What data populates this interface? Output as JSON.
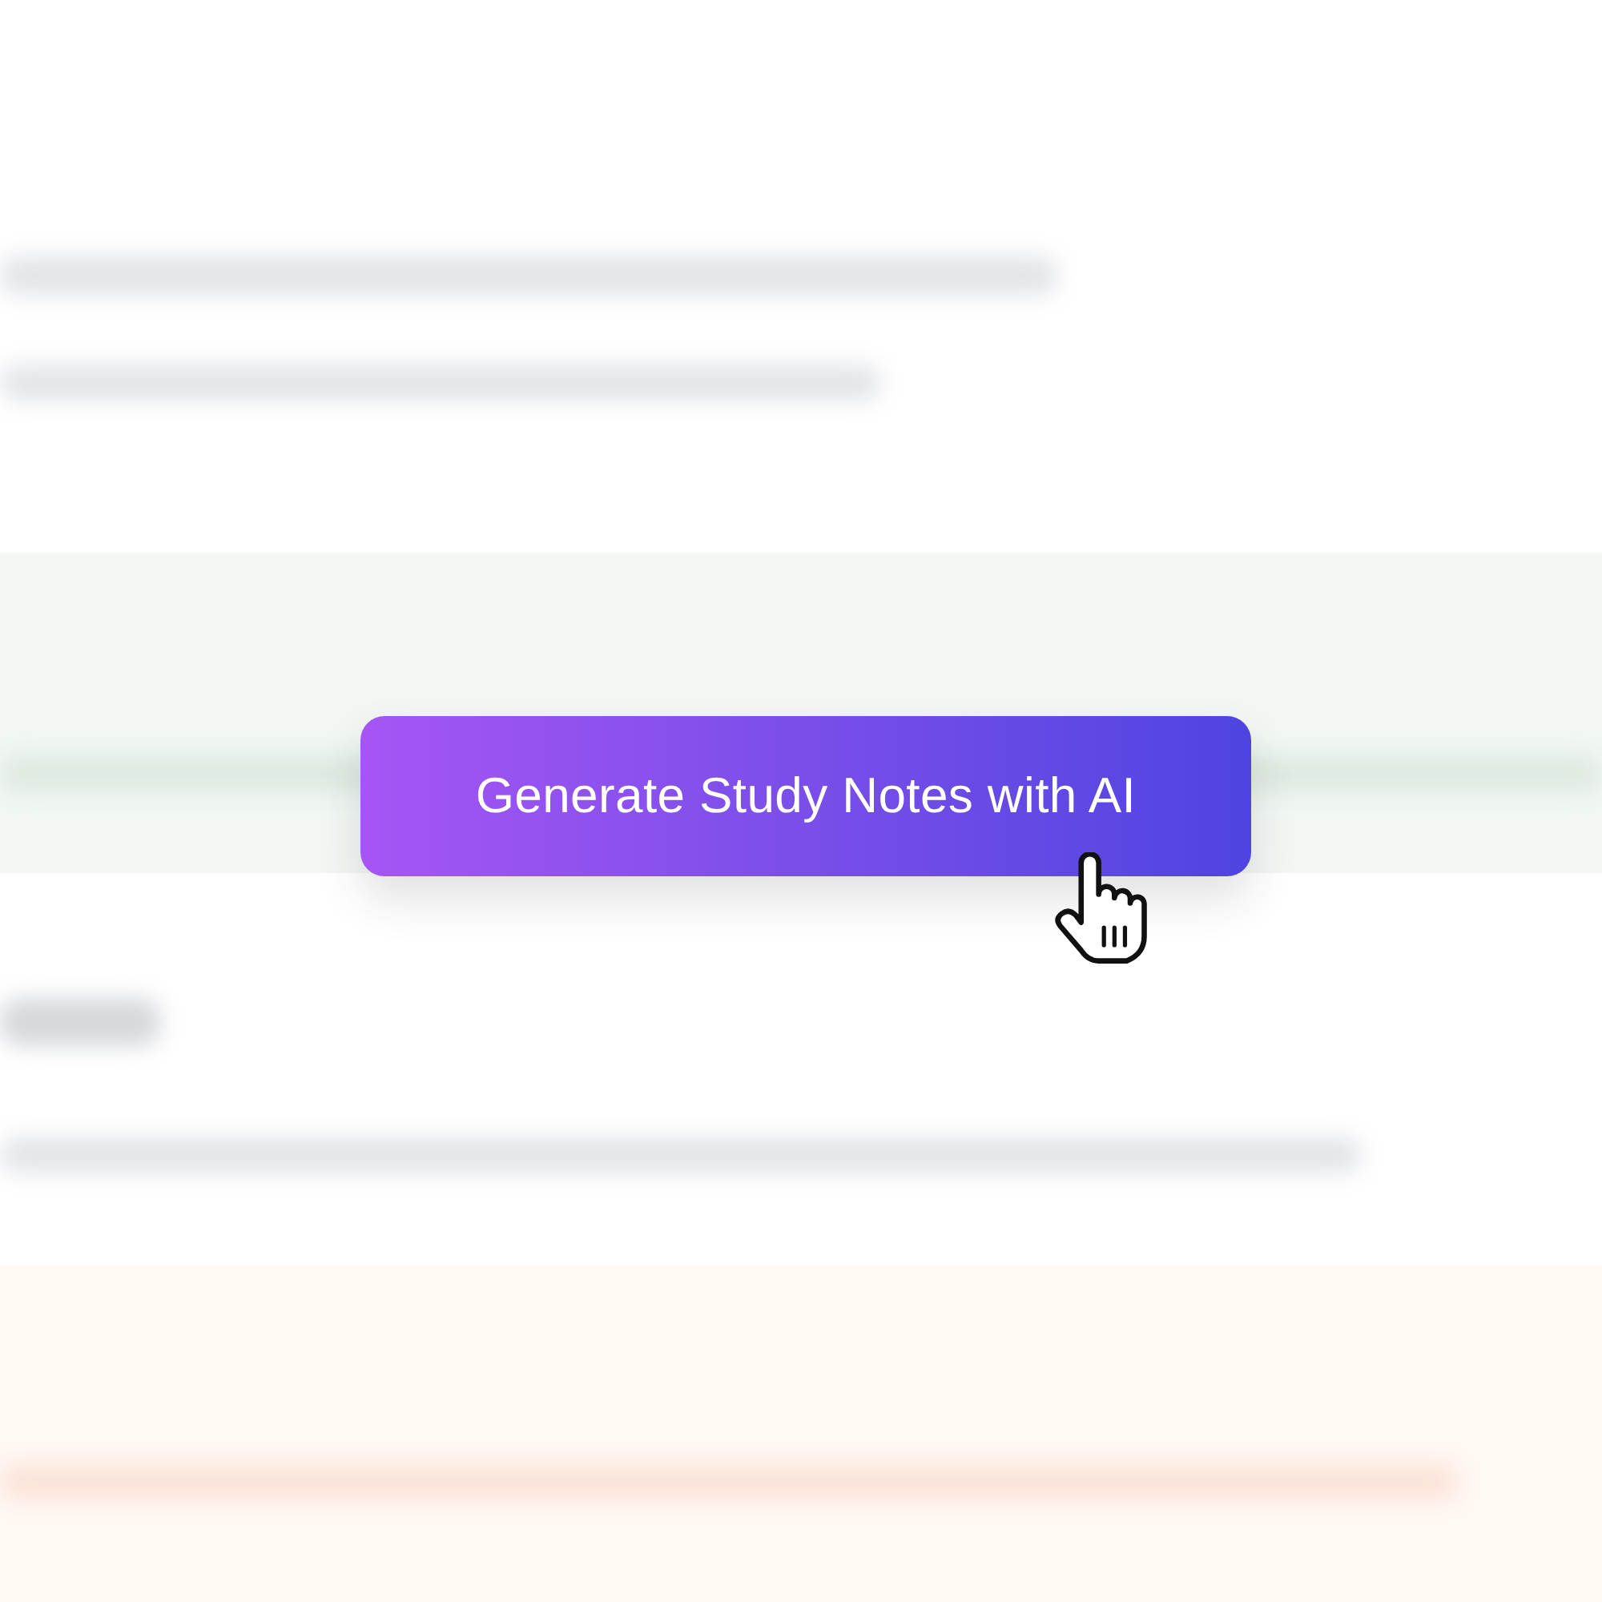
{
  "button": {
    "label": "Generate Study Notes with AI"
  }
}
